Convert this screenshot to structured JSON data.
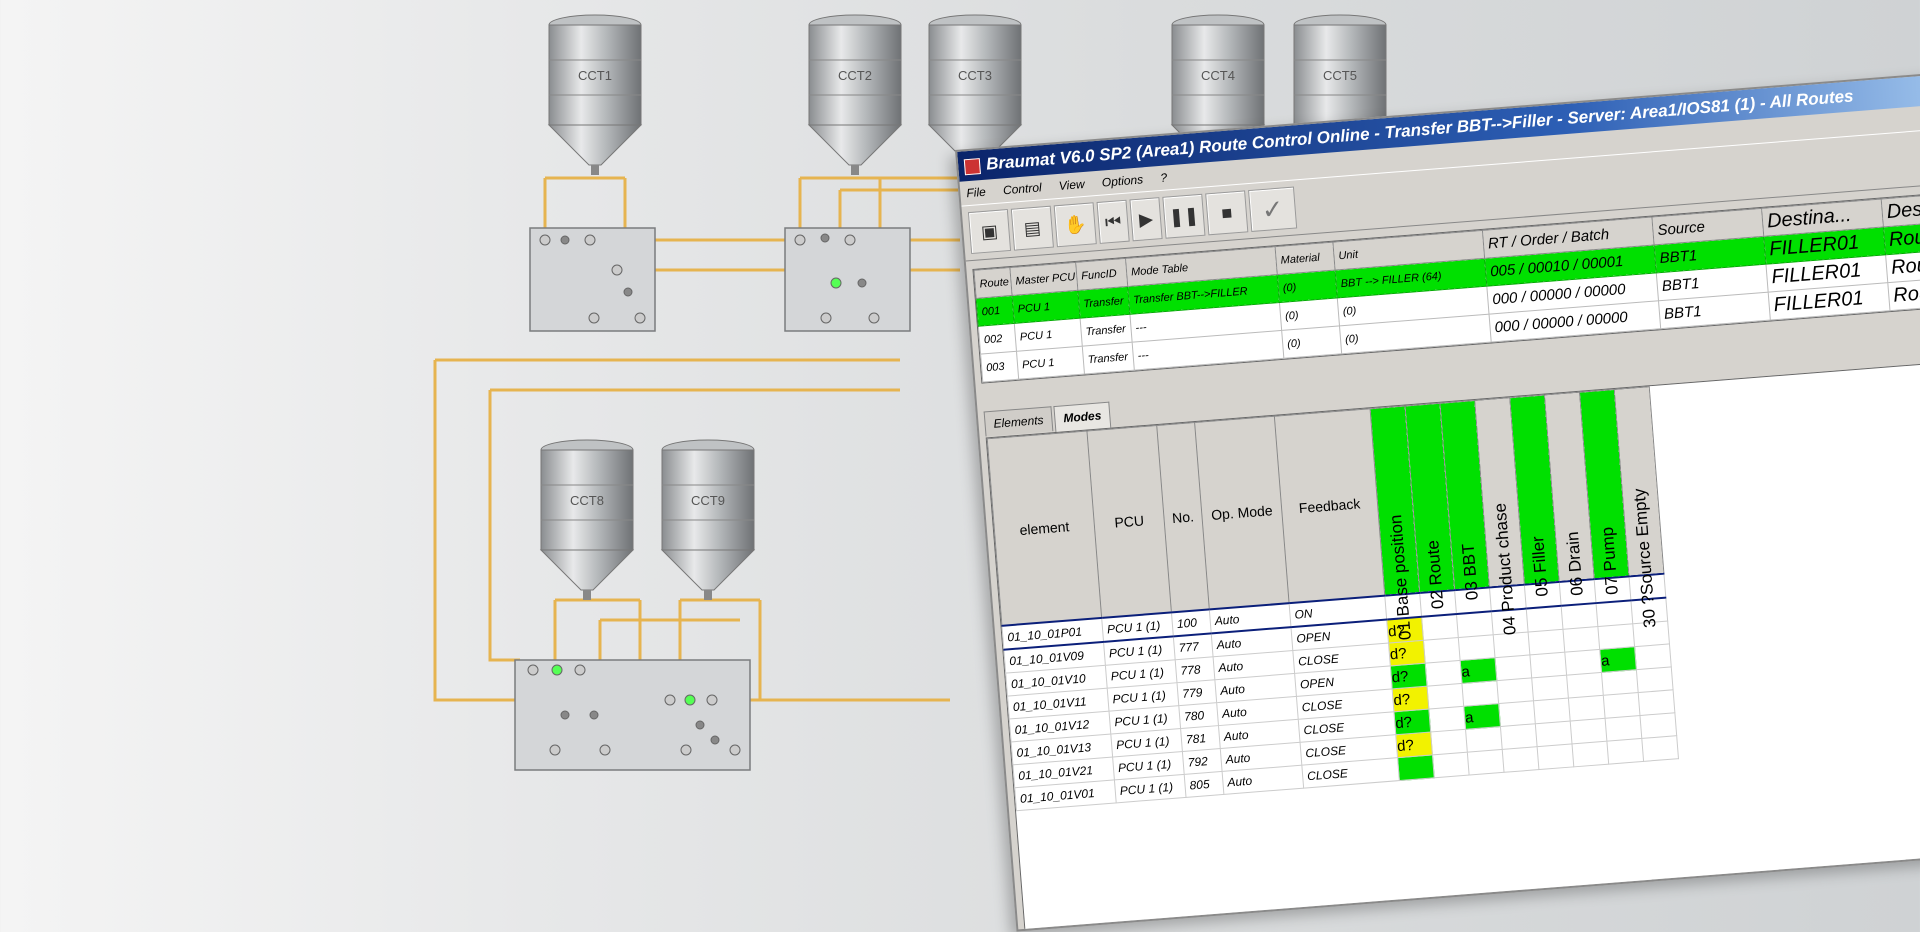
{
  "colors": {
    "accent_green": "#00e000",
    "warning_yellow": "#f2f200",
    "pipe": "#e6b450",
    "title_blue": "#0a246a"
  },
  "process_diagram": {
    "tanks": [
      "CCT1",
      "CCT2",
      "CCT3",
      "CCT4",
      "CCT5",
      "CCT8",
      "CCT9"
    ]
  },
  "window": {
    "title": "Braumat V6.0 SP2 (Area1) Route Control Online - Transfer BBT-->Filler - Server: Area1/IOS81 (1) - All Routes",
    "menu": [
      "File",
      "Control",
      "View",
      "Options",
      "?"
    ],
    "toolbar_icons": [
      "print-icon",
      "document-icon",
      "hand-icon",
      "step-back-icon",
      "play-icon",
      "pause-icon",
      "stop-icon",
      "check-icon"
    ]
  },
  "routes": {
    "headers": [
      "Route",
      "Master PCU",
      "FuncID",
      "Mode Table",
      "Material",
      "Unit",
      "RT / Order / Batch",
      "Source",
      "Destina...",
      "Description"
    ],
    "rows": [
      [
        "001",
        "PCU 1",
        "Transfer",
        "Transfer BBT-->FILLER",
        "(0)",
        "BBT --> FILLER (64)",
        "005 / 00010 / 00001",
        "BBT1",
        "FILLER01",
        "Route started"
      ],
      [
        "002",
        "PCU 1",
        "Transfer",
        "---",
        "(0)",
        "(0)",
        "000 / 00000 / 00000",
        "BBT1",
        "FILLER01",
        "Route inactive"
      ],
      [
        "003",
        "PCU 1",
        "Transfer",
        "---",
        "(0)",
        "(0)",
        "000 / 00000 / 00000",
        "BBT1",
        "FILLER01",
        "Route inactive"
      ]
    ]
  },
  "tabs": [
    "Elements",
    "Modes"
  ],
  "modes": {
    "headers": [
      "element",
      "PCU",
      "No.",
      "Op. Mode",
      "Feedback"
    ],
    "step_headers": [
      {
        "label": "01 Base position",
        "active": true
      },
      {
        "label": "02 Route",
        "active": true
      },
      {
        "label": "03 BBT",
        "active": true
      },
      {
        "label": "04 Product chase",
        "active": false
      },
      {
        "label": "05 Filler",
        "active": true
      },
      {
        "label": "06 Drain",
        "active": false
      },
      {
        "label": "07 Pump",
        "active": true
      },
      {
        "label": "30 ?Source Empty",
        "active": false
      }
    ],
    "rows": [
      {
        "element": "01_10_01P01",
        "pcu": "PCU 1 (1)",
        "no": "100",
        "mode": "Auto",
        "feedback": "ON",
        "cells": [
          "",
          "",
          "",
          "",
          "",
          "",
          "",
          ""
        ]
      },
      {
        "element": "01_10_01V09",
        "pcu": "PCU 1 (1)",
        "no": "777",
        "mode": "Auto",
        "feedback": "OPEN",
        "cells": [
          "d?",
          "",
          "",
          "",
          "",
          "",
          "",
          ""
        ]
      },
      {
        "element": "01_10_01V10",
        "pcu": "PCU 1 (1)",
        "no": "778",
        "mode": "Auto",
        "feedback": "CLOSE",
        "cells": [
          "d?",
          "",
          "",
          "",
          "",
          "",
          "",
          ""
        ]
      },
      {
        "element": "01_10_01V11",
        "pcu": "PCU 1 (1)",
        "no": "779",
        "mode": "Auto",
        "feedback": "OPEN",
        "cells": [
          "d?",
          "",
          "a",
          "",
          "",
          "",
          "a",
          ""
        ]
      },
      {
        "element": "01_10_01V12",
        "pcu": "PCU 1 (1)",
        "no": "780",
        "mode": "Auto",
        "feedback": "CLOSE",
        "cells": [
          "d?",
          "",
          "",
          "",
          "",
          "",
          "",
          ""
        ]
      },
      {
        "element": "01_10_01V13",
        "pcu": "PCU 1 (1)",
        "no": "781",
        "mode": "Auto",
        "feedback": "CLOSE",
        "cells": [
          "d?",
          "",
          "a",
          "",
          "",
          "",
          "",
          ""
        ]
      },
      {
        "element": "01_10_01V21",
        "pcu": "PCU 1 (1)",
        "no": "792",
        "mode": "Auto",
        "feedback": "CLOSE",
        "cells": [
          "d?",
          "",
          "",
          "",
          "",
          "",
          "",
          ""
        ]
      },
      {
        "element": "01_10_01V01",
        "pcu": "PCU 1 (1)",
        "no": "805",
        "mode": "Auto",
        "feedback": "CLOSE",
        "cells": [
          "",
          "",
          "",
          "",
          "",
          "",
          "",
          ""
        ]
      }
    ],
    "cell_colors": [
      [
        "",
        "",
        "",
        "",
        "",
        "",
        "",
        ""
      ],
      [
        "yel",
        "",
        "",
        "",
        "",
        "",
        "",
        ""
      ],
      [
        "yel",
        "",
        "",
        "",
        "",
        "",
        "",
        ""
      ],
      [
        "grn",
        "",
        "grn",
        "",
        "",
        "",
        "grn",
        ""
      ],
      [
        "yel",
        "",
        "",
        "",
        "",
        "",
        "",
        ""
      ],
      [
        "grn",
        "",
        "grn",
        "",
        "",
        "",
        "",
        ""
      ],
      [
        "yel",
        "",
        "",
        "",
        "",
        "",
        "",
        ""
      ],
      [
        "grn",
        "",
        "",
        "",
        "",
        "",
        "",
        ""
      ]
    ]
  }
}
